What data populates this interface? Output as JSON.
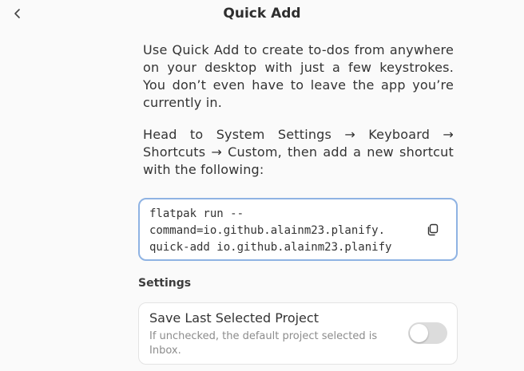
{
  "header": {
    "title": "Quick Add",
    "back_icon": "chevron-left-icon"
  },
  "intro": {
    "paragraph1": "Use Quick Add to create to-dos from anywhere on your desktop with just a few keystrokes. You don’t even have to leave the app you’re currently in.",
    "paragraph2": "Head to System Settings → Keyboard → Shortcuts → Custom, then add a new shortcut with the following:"
  },
  "command": {
    "lines": [
      "flatpak run --",
      "command=io.github.alainm23.planify.",
      "quick-add io.github.alainm23.planify"
    ],
    "copy_icon": "copy-icon"
  },
  "settings": {
    "section_label": "Settings",
    "save_last_project": {
      "title": "Save Last Selected Project",
      "subtitle": "If unchecked, the default project selected is Inbox.",
      "enabled": false
    }
  },
  "colors": {
    "accent_border": "#8fb3e3",
    "toggle_off": "#dcdcdc",
    "background": "#fafafa"
  }
}
